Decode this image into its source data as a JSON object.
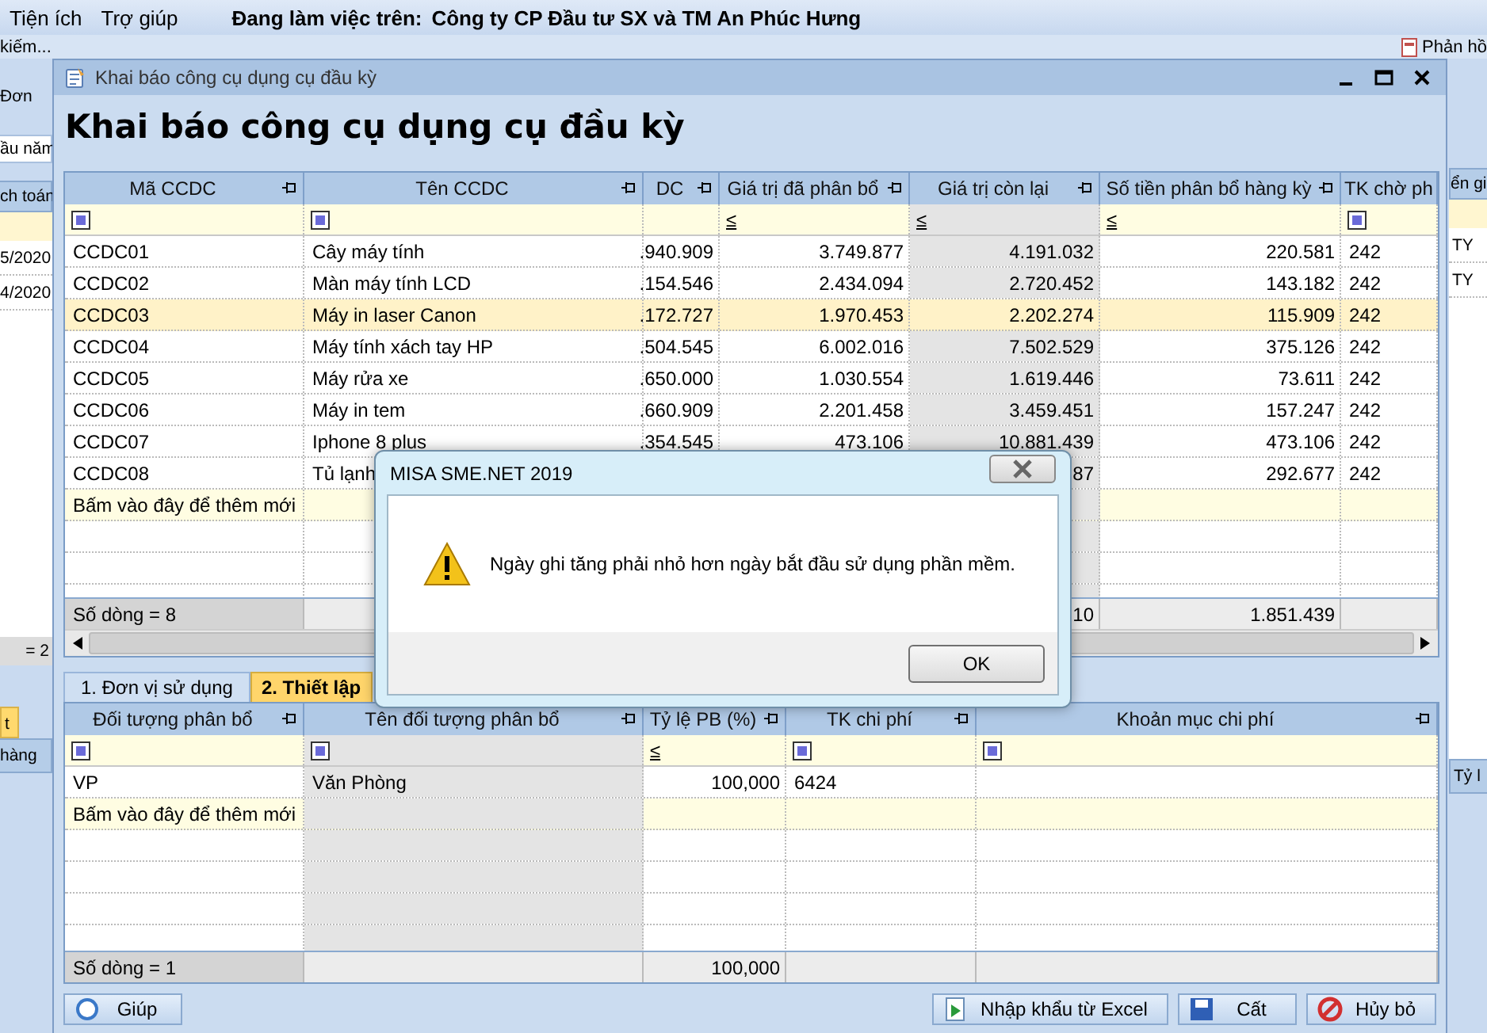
{
  "app": {
    "menu": [
      "Tiện ích",
      "Trợ giúp"
    ],
    "workspace_label": "Đang làm việc trên:",
    "company": "Công ty CP  Đầu tư SX và TM An Phúc Hưng",
    "toolbar_left": "kiếm...",
    "toolbar_right": "Phản hồ",
    "left_panel": {
      "tab": "Đơn",
      "field": "ầu năm",
      "column": "ch toán",
      "rows": [
        "5/2020",
        "4/2020"
      ],
      "footer": "= 2",
      "lower_tab": "t",
      "lower_column": "hàng"
    },
    "right_panel": {
      "column": "ển gi",
      "rows": [
        "TY",
        "TY"
      ],
      "lower_column": "Tỷ l"
    }
  },
  "window": {
    "title": "Khai báo công cụ dụng cụ đầu kỳ",
    "heading": "Khai báo công cụ dụng cụ đầu kỳ",
    "grid": {
      "columns": [
        {
          "label": "Mã CCDC",
          "kind": "text",
          "shaded": false
        },
        {
          "label": "Tên CCDC",
          "kind": "text",
          "shaded": false
        },
        {
          "label": "DC",
          "kind": "number",
          "shaded": false
        },
        {
          "label": "Giá trị đã phân bổ",
          "kind": "number",
          "filter_operator": "≤",
          "shaded": false
        },
        {
          "label": "Giá trị còn lại",
          "kind": "number",
          "filter_operator": "≤",
          "shaded": true
        },
        {
          "label": "Số tiền phân bổ hàng kỳ",
          "kind": "number",
          "filter_operator": "≤",
          "shaded": false
        },
        {
          "label": "TK chờ ph",
          "kind": "text",
          "shaded": false
        }
      ],
      "rows": [
        {
          "selected": false,
          "code": "CCDC01",
          "name": "Cây máy tính",
          "cost": ".940.909",
          "allocated": "3.749.877",
          "remaining": "4.191.032",
          "per_period": "220.581",
          "account": "242"
        },
        {
          "selected": false,
          "code": "CCDC02",
          "name": "Màn máy tính LCD",
          "cost": ".154.546",
          "allocated": "2.434.094",
          "remaining": "2.720.452",
          "per_period": "143.182",
          "account": "242"
        },
        {
          "selected": true,
          "code": "CCDC03",
          "name": "Máy in laser Canon",
          "cost": ".172.727",
          "allocated": "1.970.453",
          "remaining": "2.202.274",
          "per_period": "115.909",
          "account": "242"
        },
        {
          "selected": false,
          "code": "CCDC04",
          "name": "Máy tính xách tay HP",
          "cost": ".504.545",
          "allocated": "6.002.016",
          "remaining": "7.502.529",
          "per_period": "375.126",
          "account": "242"
        },
        {
          "selected": false,
          "code": "CCDC05",
          "name": "Máy rửa xe",
          "cost": ".650.000",
          "allocated": "1.030.554",
          "remaining": "1.619.446",
          "per_period": "73.611",
          "account": "242"
        },
        {
          "selected": false,
          "code": "CCDC06",
          "name": "Máy in tem",
          "cost": ".660.909",
          "allocated": "2.201.458",
          "remaining": "3.459.451",
          "per_period": "157.247",
          "account": "242"
        },
        {
          "selected": false,
          "code": "CCDC07",
          "name": "Iphone 8 plus",
          "cost": ".354.545",
          "allocated": "473.106",
          "remaining": "10.881.439",
          "per_period": "473.106",
          "account": "242"
        },
        {
          "selected": false,
          "code": "CCDC08",
          "name": "Tủ lạnh",
          "remaining": "87",
          "per_period": "292.677",
          "account": "242"
        }
      ],
      "new_row_prompt": "Bấm vào đây để thêm mới",
      "footer": {
        "row_count": "Số dòng = 8",
        "remaining_total": "10",
        "per_period_total": "1.851.439"
      }
    },
    "tabs": [
      {
        "label": "1. Đơn vị sử dụng",
        "selected": false
      },
      {
        "label": "2. Thiết lập",
        "selected": true
      }
    ],
    "detail_grid": {
      "columns": [
        {
          "label": "Đối tượng phân bổ",
          "kind": "text",
          "shaded": false
        },
        {
          "label": "Tên đối tượng phân bổ",
          "kind": "text",
          "shaded": true
        },
        {
          "label": "Tỷ lệ PB (%)",
          "kind": "number",
          "filter_operator": "≤",
          "shaded": false
        },
        {
          "label": "TK chi phí",
          "kind": "text",
          "shaded": false
        },
        {
          "label": "Khoản mục chi phí",
          "kind": "text",
          "shaded": false
        }
      ],
      "rows": [
        {
          "selected": false,
          "object": "VP",
          "object_name": "Văn Phòng",
          "ratio": "100,000",
          "account": "6424"
        }
      ],
      "new_row_prompt": "Bấm vào đây để thêm mới",
      "footer": {
        "row_count": "Số dòng = 1",
        "ratio_total": "100,000"
      }
    },
    "buttons": [
      {
        "label": "Giúp",
        "kind": "help"
      },
      {
        "label": "Nhập khẩu từ Excel",
        "kind": "import"
      },
      {
        "label": "Cất",
        "kind": "save"
      },
      {
        "label": "Hủy bỏ",
        "kind": "cancel"
      }
    ]
  },
  "dialog": {
    "title": "MISA SME.NET 2019",
    "message": "Ngày ghi tăng phải nhỏ hơn ngày bắt đầu sử dụng phần mềm.",
    "kind": "warning",
    "buttons": [
      "OK"
    ]
  }
}
